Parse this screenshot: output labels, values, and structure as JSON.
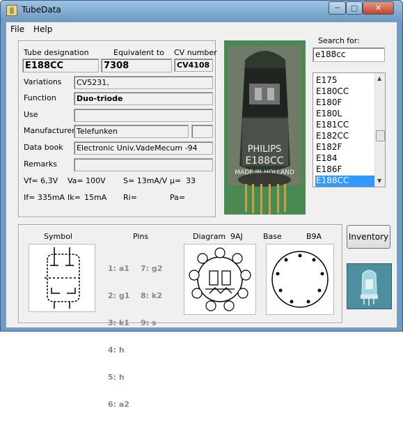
{
  "window": {
    "title": "TubeData",
    "minimize": "─",
    "maximize": "□",
    "close": "✕"
  },
  "menu": {
    "file": "File",
    "help": "Help"
  },
  "header": {
    "designation_label": "Tube designation",
    "equivalent_label": "Equivalent to",
    "cv_label": "CV number",
    "designation": "E188CC",
    "equivalent": "7308",
    "cv": "CV4108"
  },
  "fields": {
    "variations_label": "Variations",
    "variations": "CV5231,",
    "function_label": "Function",
    "function": "Duo-triode",
    "use_label": "Use",
    "use": "",
    "manufacturer_label": "Manufacturer",
    "manufacturer": "Telefunken",
    "manufacturer_extra": "",
    "databook_label": "Data book",
    "databook": "Electronic Univ.VadeMecum -94",
    "remarks_label": "Remarks",
    "remarks": ""
  },
  "specs": {
    "vf": "Vf= 6,3V",
    "va": "Va= 100V",
    "s": "S= 13mA/V",
    "mu": "µ=",
    "mu_value": "33",
    "if": "If= 335mA",
    "ik": "Ik=",
    "ik_value": "15mA",
    "ri": "Ri=",
    "pa": "Pa="
  },
  "photo": {
    "brand": "PHILIPS",
    "type": "E188CC",
    "origin": "MADE IN HOLLAND"
  },
  "search": {
    "label": "Search for:",
    "value": "e188cc"
  },
  "tube_list": {
    "items": [
      "E175",
      "E180CC",
      "E180F",
      "E180L",
      "E181CC",
      "E182CC",
      "E182F",
      "E184",
      "E186F",
      "E188CC"
    ],
    "selected": "E188CC"
  },
  "bottom": {
    "symbol_label": "Symbol",
    "pins_label": "Pins",
    "diagram_label": "Diagram",
    "diagram_code": "9AJ",
    "base_label": "Base",
    "base_code": "B9A",
    "pins_left": [
      "1: a1",
      "2: g1",
      "3: k1",
      "4: h",
      "5: h",
      "6: a2"
    ],
    "pins_right": [
      "7: g2",
      "8: k2",
      "9: s"
    ]
  },
  "inventory_button": "Inventory",
  "colors": {
    "selection": "#3399ff",
    "photo_bg": "#4a8a52",
    "titlebar": "#6f9cc4"
  }
}
